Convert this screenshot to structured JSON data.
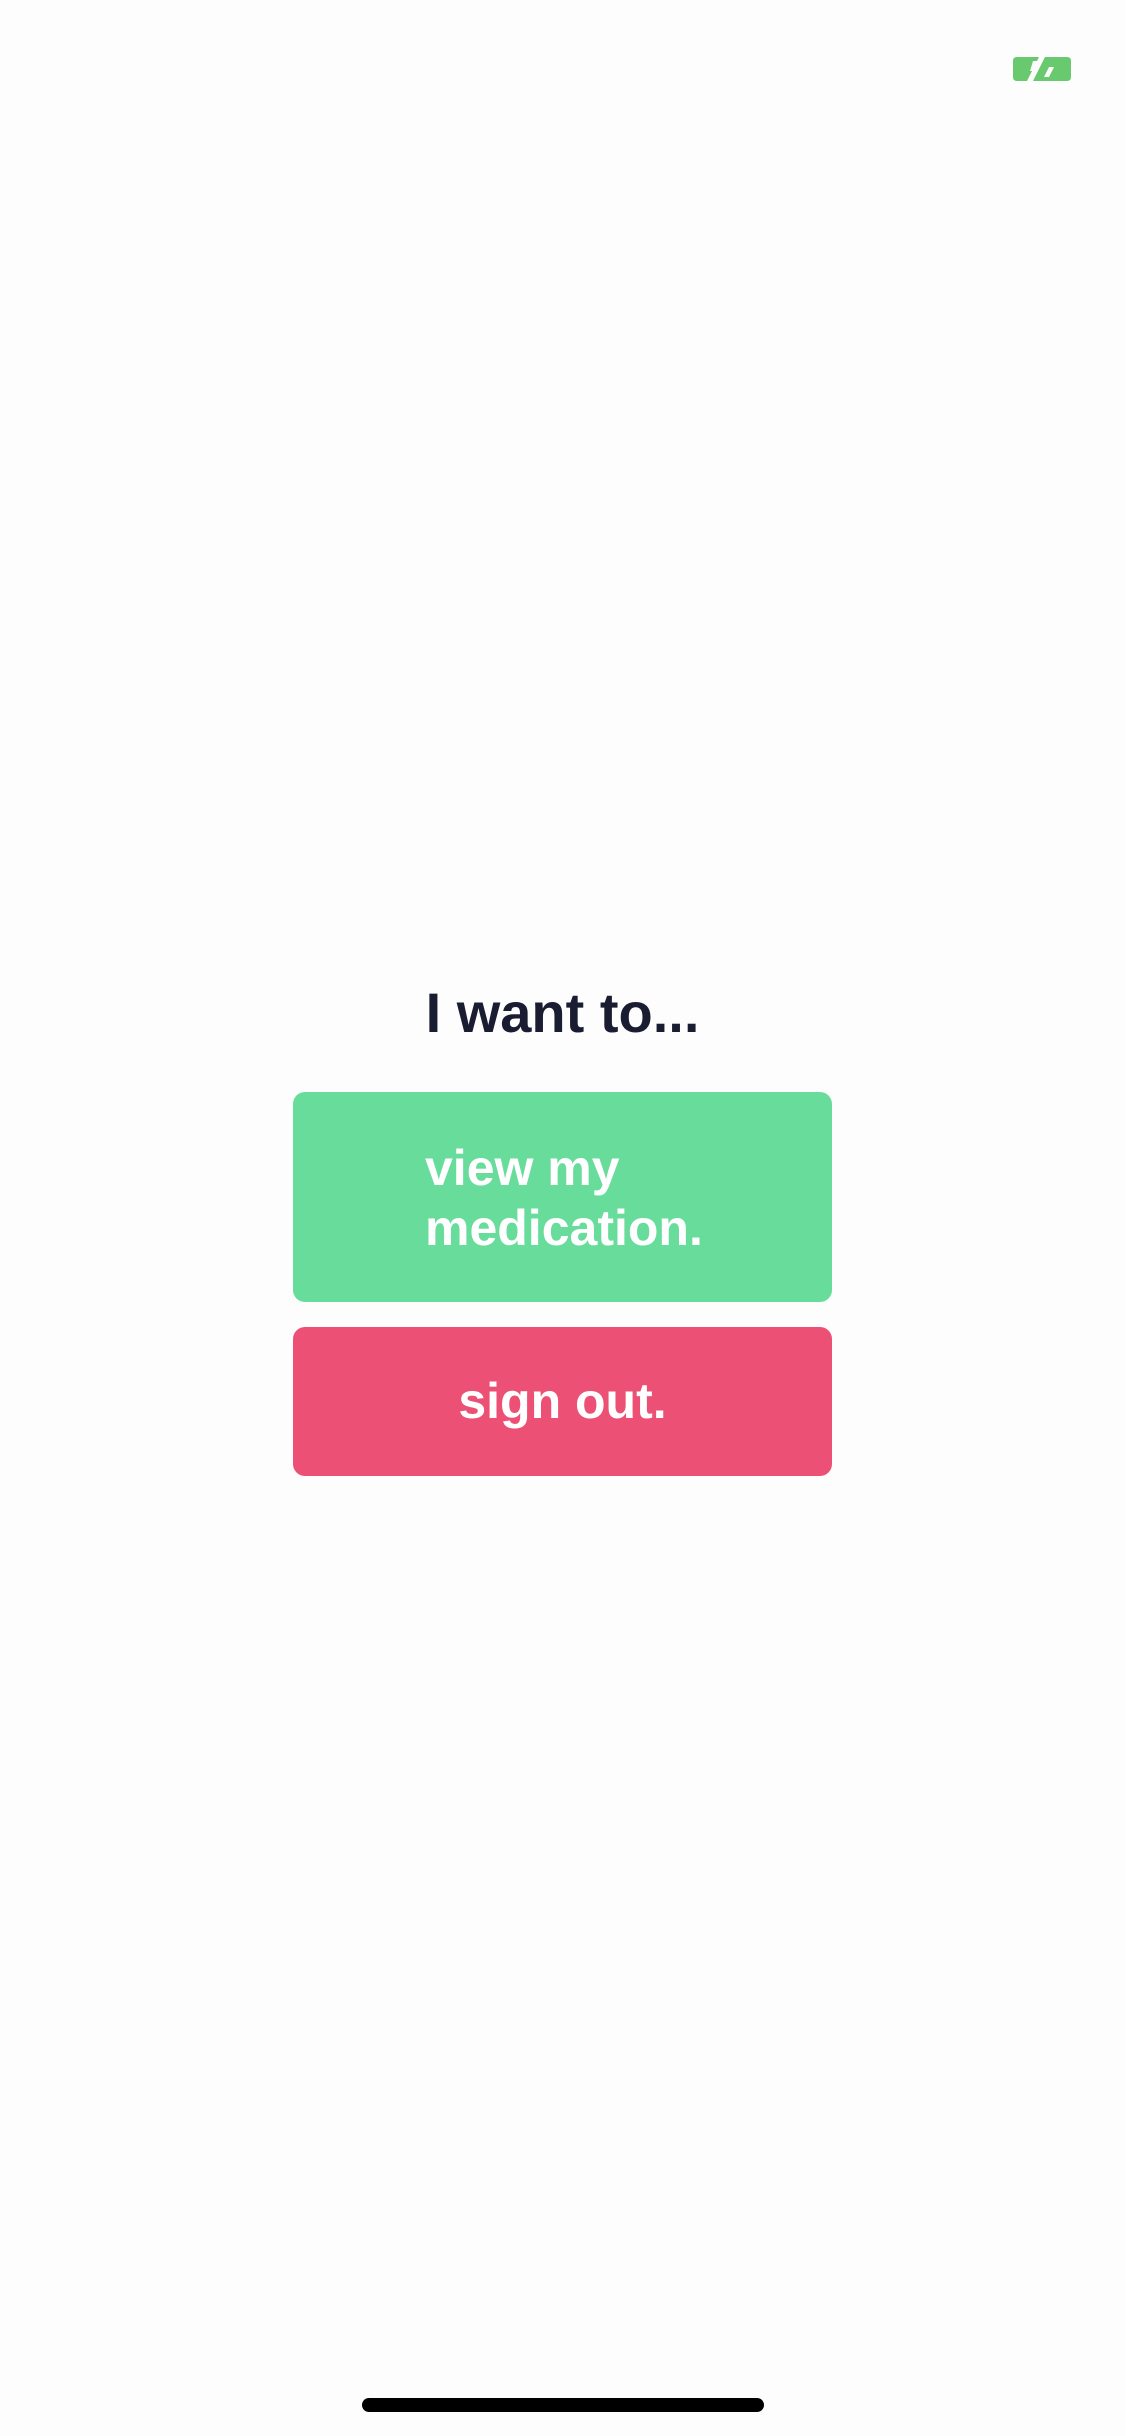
{
  "status_bar": {
    "battery_icon": "battery-charging-icon",
    "battery_color": "#68c96f"
  },
  "main": {
    "heading": "I want to...",
    "view_medication_label": "view my medication.",
    "sign_out_label": "sign out."
  },
  "colors": {
    "primary_green": "#68dc9b",
    "danger_pink": "#ec5175",
    "heading_text": "#1a1c32"
  }
}
